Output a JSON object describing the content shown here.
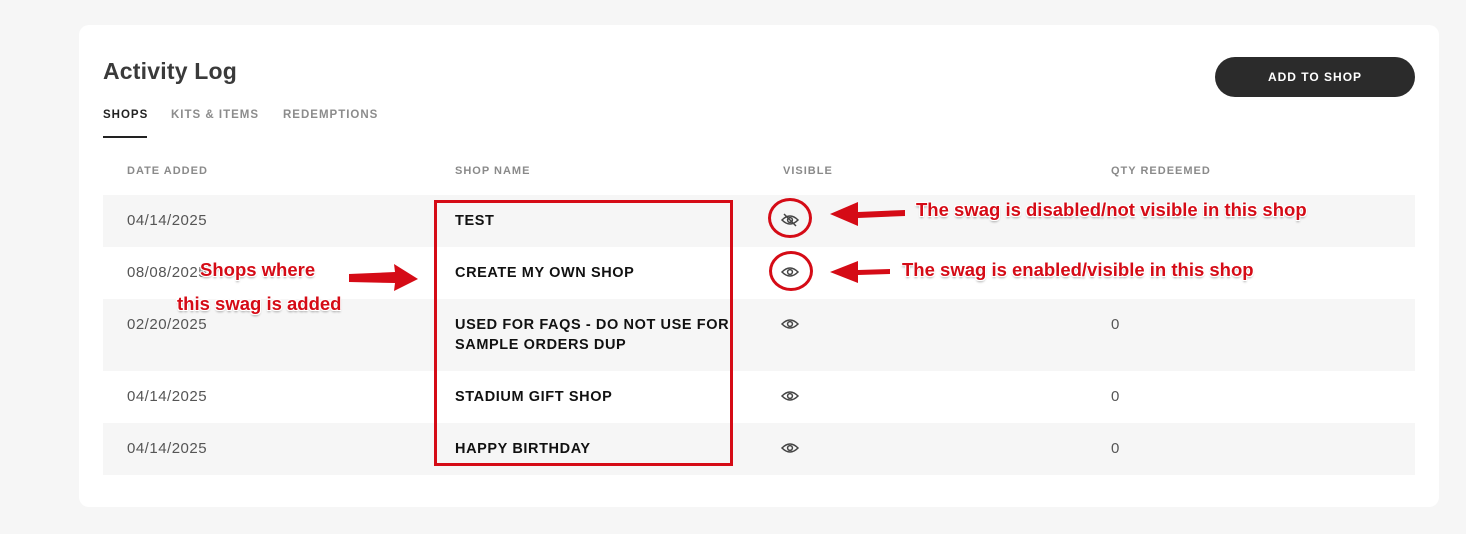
{
  "page": {
    "title": "Activity Log",
    "add_button": "ADD TO SHOP"
  },
  "tabs": [
    {
      "label": "SHOPS",
      "active": true
    },
    {
      "label": "KITS & ITEMS",
      "active": false
    },
    {
      "label": "REDEMPTIONS",
      "active": false
    }
  ],
  "table": {
    "headers": [
      "DATE ADDED",
      "SHOP NAME",
      "VISIBLE",
      "QTY REDEEMED"
    ],
    "rows": [
      {
        "date": "04/14/2025",
        "shop": "TEST",
        "visible": false,
        "visible_icon": "eye-slash-icon",
        "qty": ""
      },
      {
        "date": "08/08/2025",
        "shop": "CREATE MY OWN SHOP",
        "visible": true,
        "visible_icon": "eye-icon",
        "qty": ""
      },
      {
        "date": "02/20/2025",
        "shop": "USED FOR FAQS - DO NOT USE FOR SAMPLE ORDERS DUP",
        "visible": true,
        "visible_icon": "eye-icon",
        "qty": "0"
      },
      {
        "date": "04/14/2025",
        "shop": "STADIUM GIFT SHOP",
        "visible": true,
        "visible_icon": "eye-icon",
        "qty": "0"
      },
      {
        "date": "04/14/2025",
        "shop": "HAPPY BIRTHDAY",
        "visible": true,
        "visible_icon": "eye-icon",
        "qty": "0"
      }
    ]
  },
  "annotations": {
    "shops_line1": "Shops where",
    "shops_line2": "this swag is added",
    "disabled": "The swag is disabled/not visible in this shop",
    "enabled": "The swag is enabled/visible in this shop",
    "color": "#d50b16"
  }
}
